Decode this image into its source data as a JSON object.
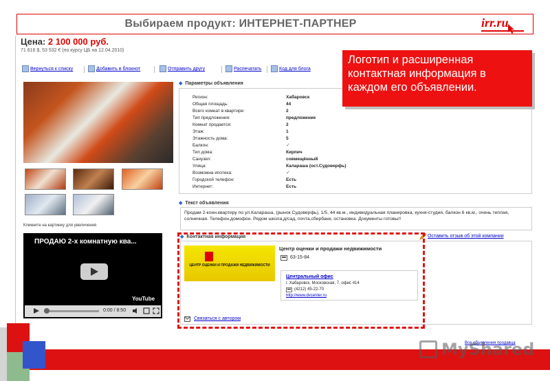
{
  "slide": {
    "title": "Выбираем продукт: ИНТЕРНЕТ-ПАРТНЕР",
    "logo": "irr.ru"
  },
  "listing": {
    "price_label": "Цена:",
    "price_value": "2 100 000 руб.",
    "price_sub": "71 616 $, 53 532 € (по курсу ЦБ на 12.04.2010)"
  },
  "toolbar": {
    "items": [
      "Вернуться к списку",
      "Добавить в блокнот",
      "Отправить другу",
      "Распечатать",
      "Код для блога"
    ]
  },
  "photos": {
    "click_note": "Кликните на картинку для увеличения"
  },
  "video": {
    "title": "ПРОДАЮ 2-х комнатную ква...",
    "brand": "YouTube",
    "time": "0:00 / 8:50"
  },
  "params": {
    "heading": "Параметры объявления",
    "rows": [
      {
        "key": "Регион:",
        "value": "Хабаровск"
      },
      {
        "key": "Общая площадь:",
        "value": "44"
      },
      {
        "key": "Всего комнат в квартире:",
        "value": "2"
      },
      {
        "key": "Тип предложения:",
        "value": "предложение"
      },
      {
        "key": "Комнат продается:",
        "value": "2"
      },
      {
        "key": "Этаж:",
        "value": "1"
      },
      {
        "key": "Этажность дома:",
        "value": "5"
      },
      {
        "key": "Балкон:",
        "value": "✓"
      },
      {
        "key": "Тип дома:",
        "value": "Кирпич"
      },
      {
        "key": "Санузел:",
        "value": "совмещённый"
      },
      {
        "key": "Улица:",
        "value": "Калараша (ост.Судоверфь)"
      },
      {
        "key": "Возможна ипотека:",
        "value": "✓"
      },
      {
        "key": "Городской телефон:",
        "value": "Есть"
      },
      {
        "key": "Интернет:",
        "value": "Есть"
      }
    ]
  },
  "ad_text": {
    "heading": "Текст объявления",
    "body": "Продам 2-конн.квартиру по ул.Калараша, (рынок Судоверфь), 1/5, 44 кв.м., индивидуальная планировка, кухня-студия, балкон 6 кв.м., очень теплая, солнечная. Телефон,домофон. Рядом школа,д/сад, почта,сбербанк, остановка. Документы готовы!!"
  },
  "contact": {
    "heading": "Контактная информация",
    "feedback_link": "Оставить отзыв об этой компании",
    "agency_logo_text": "ЦЕНТР ОЦЕНКИ И ПРОДАЖИ НЕДВИЖИМОСТИ",
    "agency_name": "Центр оценки и продажи недвижимости",
    "agency_phone": "63-15-84",
    "office_title": "Центральный офис",
    "office_address": "г. Хабаровск, Московская, 7, офис 414",
    "office_phone": "(4212) 45-22-70",
    "office_site": "http://www.dvcenter.ru",
    "contact_author": "Связаться с автором",
    "all_ads": "Все объявления продавца"
  },
  "callout": {
    "text": "Логотип и расширенная контактная информация в каждом его объявлении."
  },
  "watermark": "MyShared",
  "colors": {
    "accent": "#dd1111",
    "link": "#0000cc",
    "callout": "#ee1111"
  }
}
